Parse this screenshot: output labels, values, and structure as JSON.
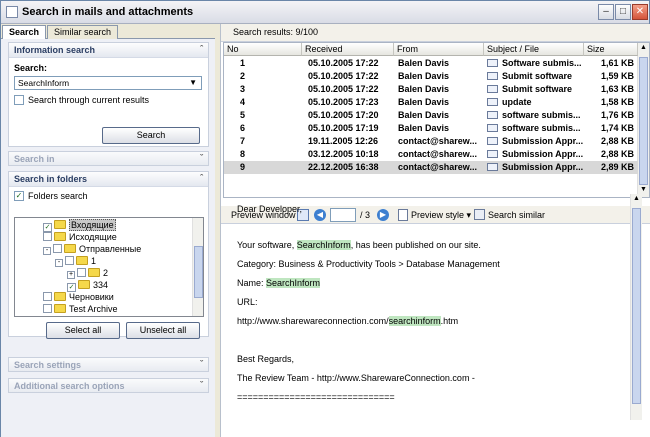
{
  "window": {
    "title": "Search in mails and attachments"
  },
  "tabs": [
    "Search",
    "Similar search"
  ],
  "info": {
    "header": "Information search",
    "search_label": "Search:",
    "search_value": "SearchInform",
    "through_label": "Search through current results",
    "search_button": "Search"
  },
  "collapsed": {
    "search_in": "Search in",
    "search_settings": "Search settings",
    "additional": "Additional search options"
  },
  "folders": {
    "header": "Search in folders",
    "folders_search": "Folders search",
    "items": [
      {
        "label": "Входящие",
        "level": 1,
        "checked": true,
        "selected": true
      },
      {
        "label": "Исходящие",
        "level": 1,
        "checked": false
      },
      {
        "label": "Отправленные",
        "level": 1,
        "checked": false,
        "expander": "-"
      },
      {
        "label": "1",
        "level": 2,
        "checked": false,
        "expander": "-"
      },
      {
        "label": "2",
        "level": 3,
        "checked": false,
        "expander": "+"
      },
      {
        "label": "334",
        "level": 3,
        "checked": true
      },
      {
        "label": "Черновики",
        "level": 1,
        "checked": false
      },
      {
        "label": "Test Archive",
        "level": 1,
        "checked": false
      }
    ],
    "select_all": "Select all",
    "unselect_all": "Unselect all"
  },
  "results": {
    "summary": "Search results:  9/100",
    "columns": [
      "No",
      "Received",
      "From",
      "Subject / File",
      "Size"
    ],
    "rows": [
      {
        "no": "1",
        "received": "05.10.2005 17:22",
        "from": "Balen Davis",
        "subject": "Software submis...",
        "size": "1,61 KB"
      },
      {
        "no": "2",
        "received": "05.10.2005 17:22",
        "from": "Balen Davis",
        "subject": "Submit software",
        "size": "1,59 KB"
      },
      {
        "no": "3",
        "received": "05.10.2005 17:22",
        "from": "Balen Davis",
        "subject": "Submit software",
        "size": "1,63 KB"
      },
      {
        "no": "4",
        "received": "05.10.2005 17:23",
        "from": "Balen Davis",
        "subject": "update",
        "size": "1,58 KB"
      },
      {
        "no": "5",
        "received": "05.10.2005 17:20",
        "from": "Balen Davis",
        "subject": "software submis...",
        "size": "1,76 KB"
      },
      {
        "no": "6",
        "received": "05.10.2005 17:19",
        "from": "Balen Davis",
        "subject": "software submis...",
        "size": "1,74 KB"
      },
      {
        "no": "7",
        "received": "19.11.2005 12:26",
        "from": "contact@sharew...",
        "subject": "Submission Appr...",
        "size": "2,88 KB"
      },
      {
        "no": "8",
        "received": "03.12.2005 10:18",
        "from": "contact@sharew...",
        "subject": "Submission Appr...",
        "size": "2,88 KB"
      },
      {
        "no": "9",
        "received": "22.12.2005 16:38",
        "from": "contact@sharew...",
        "subject": "Submission Appr...",
        "size": "2,89 KB"
      }
    ]
  },
  "preview": {
    "window_label": "Preview window",
    "page_value": "",
    "page_total": "/ 3",
    "style_label": "Preview style",
    "similar_label": "Search similar",
    "lines": [
      {
        "pre": "Dear Developer,",
        "hl": "",
        "post": ""
      },
      {
        "pre": "",
        "hl": "",
        "post": ""
      },
      {
        "pre": "Your software, ",
        "hl": "SearchInform",
        "post": ", has been published on our site."
      },
      {
        "pre": "Category: Business & Productivity Tools > Database Management",
        "hl": "",
        "post": ""
      },
      {
        "pre": "Name: ",
        "hl": "SearchInform",
        "post": ""
      },
      {
        "pre": "URL:",
        "hl": "",
        "post": ""
      },
      {
        "pre": "http://www.sharewareconnection.com/",
        "hl": "searchinform",
        "post": ".htm"
      },
      {
        "pre": "",
        "hl": "",
        "post": ""
      },
      {
        "pre": "Best Regards,",
        "hl": "",
        "post": ""
      },
      {
        "pre": "The Review Team - http://www.SharewareConnection.com -",
        "hl": "",
        "post": ""
      },
      {
        "pre": "==============================",
        "hl": "",
        "post": ""
      }
    ]
  }
}
